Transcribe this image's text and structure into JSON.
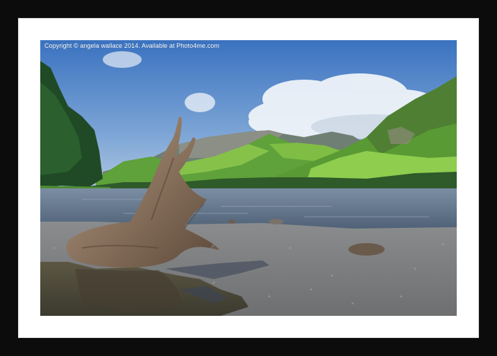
{
  "watermark": {
    "text": "Copyright © angela wallace 2014. Available at Photo4me.com"
  },
  "colors": {
    "frame": "#0c0c0c",
    "mount": "#ffffff",
    "sky_top": "#3f78c4",
    "lake": "#5b6f86",
    "grass": "#6fb83a",
    "driftwood": "#8a735e"
  }
}
